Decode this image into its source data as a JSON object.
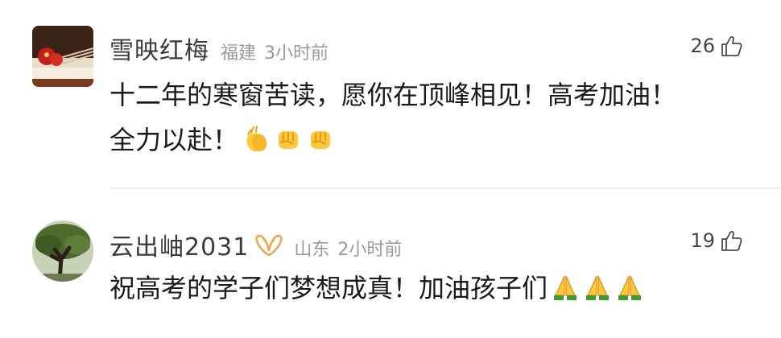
{
  "comments": [
    {
      "username": "雪映红梅",
      "location": "福建",
      "time": "3小时前",
      "likes": "26",
      "text_line1": "十二年的寒窗苦读，愿你在顶峰相见！高考加油！",
      "text_line2": "全力以赴！",
      "emojis": [
        "clapping-hands",
        "raised-fist",
        "raised-fist"
      ]
    },
    {
      "username": "云出岫2031",
      "badge_icon": "vip-badge-icon",
      "location": "山东",
      "time": "2小时前",
      "likes": "19",
      "text": "祝高考的学子们梦想成真！加油孩子们",
      "emojis": [
        "folded-hands",
        "folded-hands",
        "folded-hands"
      ]
    }
  ],
  "colors": {
    "meta": "#9a9a9a",
    "username": "#3a3a3a",
    "text": "#1a1a1a",
    "badge": "#f2a24a"
  }
}
